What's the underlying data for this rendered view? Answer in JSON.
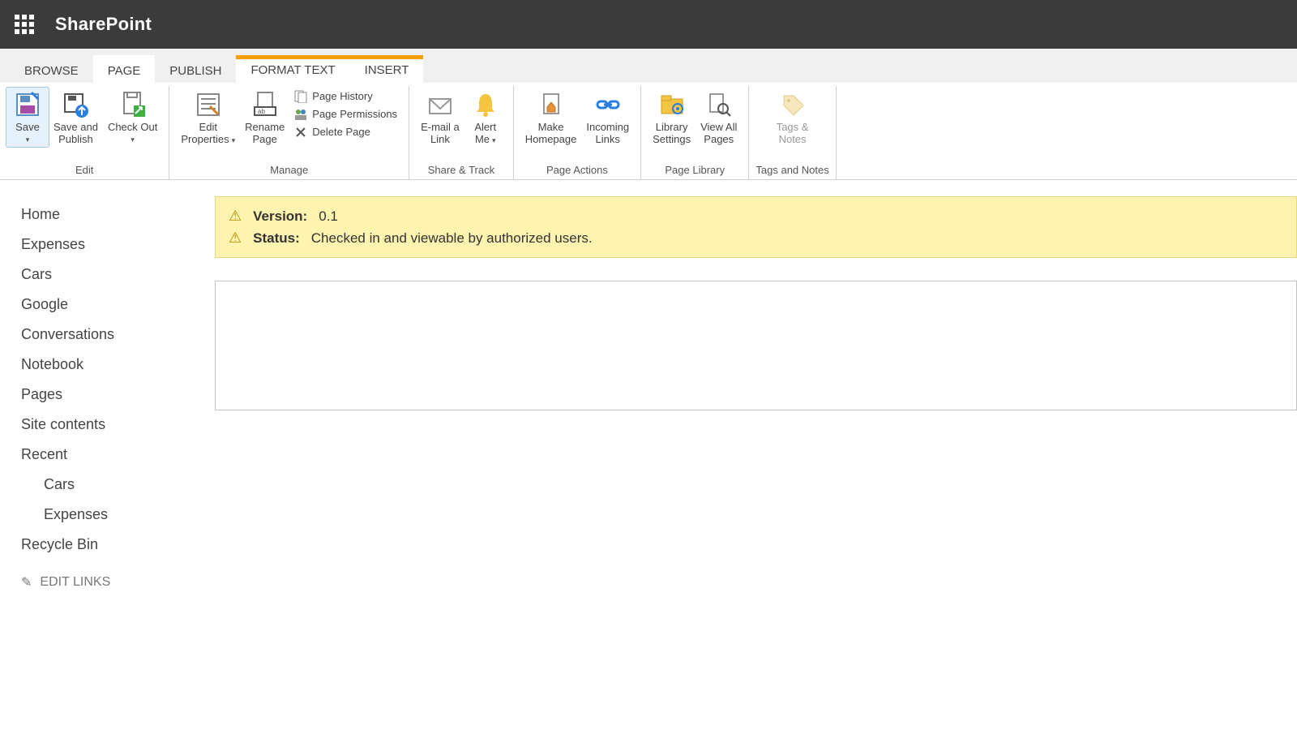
{
  "header": {
    "app_name": "SharePoint"
  },
  "tabs": {
    "browse": "BROWSE",
    "page": "PAGE",
    "publish": "PUBLISH",
    "format_text": "FORMAT TEXT",
    "insert": "INSERT"
  },
  "ribbon": {
    "edit_group": "Edit",
    "manage_group": "Manage",
    "share_group": "Share & Track",
    "actions_group": "Page Actions",
    "library_group": "Page Library",
    "tags_group": "Tags and Notes",
    "save": "Save",
    "save_publish_1": "Save and",
    "save_publish_2": "Publish",
    "check_out": "Check Out",
    "edit_props_1": "Edit",
    "edit_props_2": "Properties",
    "rename_1": "Rename",
    "rename_2": "Page",
    "page_history": "Page History",
    "page_permissions": "Page Permissions",
    "delete_page": "Delete Page",
    "email_1": "E-mail a",
    "email_2": "Link",
    "alert_1": "Alert",
    "alert_2": "Me",
    "make_home_1": "Make",
    "make_home_2": "Homepage",
    "incoming_1": "Incoming",
    "incoming_2": "Links",
    "lib_settings_1": "Library",
    "lib_settings_2": "Settings",
    "view_all_1": "View All",
    "view_all_2": "Pages",
    "tags_1": "Tags &",
    "tags_2": "Notes"
  },
  "sidebar": {
    "items": [
      {
        "label": "Home"
      },
      {
        "label": "Expenses"
      },
      {
        "label": "Cars"
      },
      {
        "label": "Google"
      },
      {
        "label": "Conversations"
      },
      {
        "label": "Notebook"
      },
      {
        "label": "Pages"
      },
      {
        "label": "Site contents"
      },
      {
        "label": "Recent"
      }
    ],
    "recent": [
      {
        "label": "Cars"
      },
      {
        "label": "Expenses"
      }
    ],
    "recycle": "Recycle Bin",
    "edit_links": "EDIT LINKS"
  },
  "status": {
    "version_label": "Version:",
    "version_value": "0.1",
    "status_label": "Status:",
    "status_value": "Checked in and viewable by authorized users."
  }
}
